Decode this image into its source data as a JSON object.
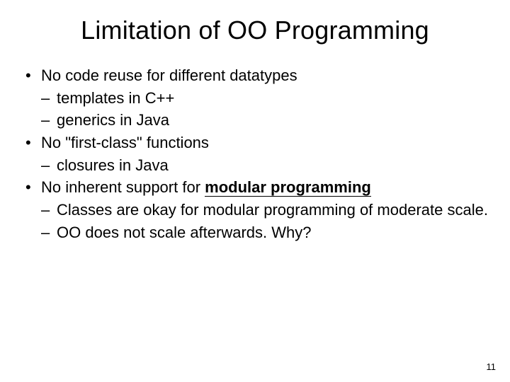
{
  "title": "Limitation of OO Programming",
  "bullets": {
    "b1": "No code reuse for different datatypes",
    "b1a": "templates in C++",
    "b1b": "generics in Java",
    "b2": "No \"first-class\" functions",
    "b2a": "closures in Java",
    "b3_pre": "No inherent support for ",
    "b3_emph": "modular programming",
    "b3a": "Classes are okay for modular programming of moderate scale.",
    "b3b": "OO does not scale afterwards. Why?"
  },
  "page_number": "11"
}
